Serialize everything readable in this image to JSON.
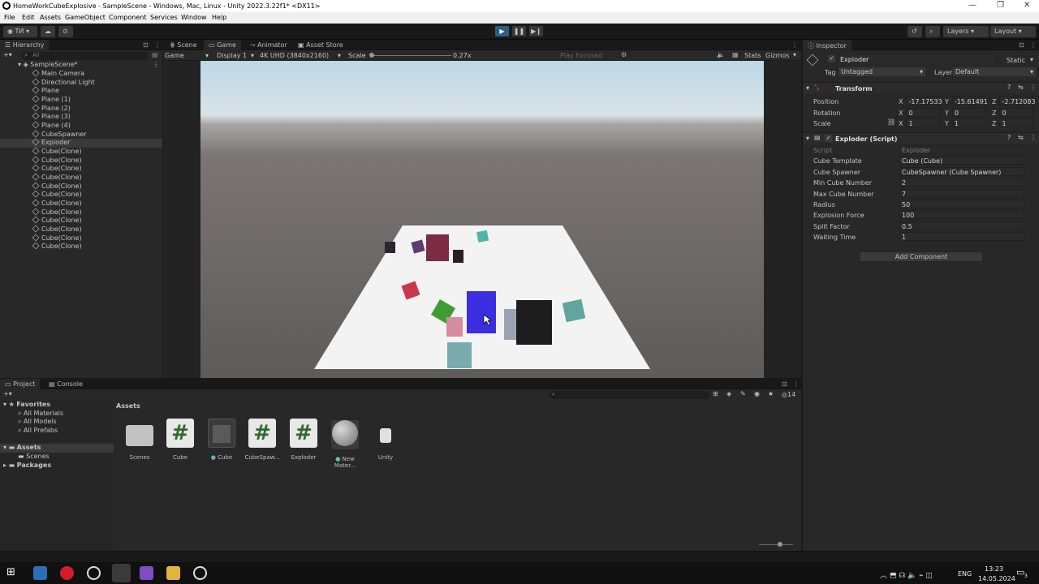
{
  "window": {
    "title": "HomeWorkCubeExplosive - SampleScene - Windows, Mac, Linux - Unity 2022.3.22f1* <DX11>"
  },
  "menu": [
    "File",
    "Edit",
    "Assets",
    "GameObject",
    "Component",
    "Services",
    "Window",
    "Help"
  ],
  "toolbar": {
    "account": "ТИ",
    "layers": "Layers",
    "layout": "Layout"
  },
  "hierarchy": {
    "tab": "Hierarchy",
    "search_placeholder": "All",
    "scene": "SampleScene*",
    "items": [
      "Main Camera",
      "Directional Light",
      "Plane",
      "Plane (1)",
      "Plane (2)",
      "Plane (3)",
      "Plane (4)",
      "CubeSpawner",
      "Exploder",
      "Cube(Clone)",
      "Cube(Clone)",
      "Cube(Clone)",
      "Cube(Clone)",
      "Cube(Clone)",
      "Cube(Clone)",
      "Cube(Clone)",
      "Cube(Clone)",
      "Cube(Clone)",
      "Cube(Clone)",
      "Cube(Clone)",
      "Cube(Clone)"
    ],
    "selected": "Exploder"
  },
  "center_tabs": [
    "Scene",
    "Game",
    "Animator",
    "Asset Store"
  ],
  "game_bar": {
    "mode": "Game",
    "display": "Display 1",
    "resolution": "4K UHD (3840x2160)",
    "scale_label": "Scale",
    "scale_value": "0.27x",
    "play_focused": "Play Focused",
    "stats": "Stats",
    "gizmos": "Gizmos"
  },
  "inspector": {
    "tab": "Inspector",
    "object_name": "Exploder",
    "static": "Static",
    "tag_label": "Tag",
    "tag": "Untagged",
    "layer_label": "Layer",
    "layer": "Default",
    "transform": {
      "title": "Transform",
      "position_label": "Position",
      "pos_x": "-17.17533",
      "pos_y": "-15.61491",
      "pos_z": "-2.712083",
      "rotation_label": "Rotation",
      "rot_x": "0",
      "rot_y": "0",
      "rot_z": "0",
      "scale_label": "Scale",
      "sc_x": "1",
      "sc_y": "1",
      "sc_z": "1",
      "x": "X",
      "y": "Y",
      "z": "Z"
    },
    "script": {
      "title": "Exploder (Script)",
      "fields": [
        {
          "label": "Script",
          "value": "Exploder"
        },
        {
          "label": "Cube Template",
          "value": "Cube (Cube)"
        },
        {
          "label": "Cube Spawner",
          "value": "CubeSpawner (Cube Spawner)"
        },
        {
          "label": "Min Cube Number",
          "value": "2"
        },
        {
          "label": "Max Cube Number",
          "value": "7"
        },
        {
          "label": "Radius",
          "value": "50"
        },
        {
          "label": "Explosion Force",
          "value": "100"
        },
        {
          "label": "Split Factor",
          "value": "0.5"
        },
        {
          "label": "Waiting Time",
          "value": "1"
        }
      ]
    },
    "add_component": "Add Component"
  },
  "project": {
    "tabs": [
      "Project",
      "Console"
    ],
    "count": "14",
    "favorites": "Favorites",
    "fav_items": [
      "All Materials",
      "All Models",
      "All Prefabs"
    ],
    "assets_root": "Assets",
    "assets_children": [
      "Scenes"
    ],
    "packages": "Packages",
    "breadcrumb": "Assets",
    "assets": [
      "Scenes",
      "Cube",
      "Cube",
      "CubeSpaw...",
      "Exploder",
      "New Mater...",
      "Unity"
    ]
  },
  "taskbar": {
    "lang": "ENG",
    "time": "13:23",
    "date": "14.05.2024",
    "notif": "3"
  },
  "colors": {
    "accent": "#3b62b1",
    "play_active": "#2c5d87"
  }
}
